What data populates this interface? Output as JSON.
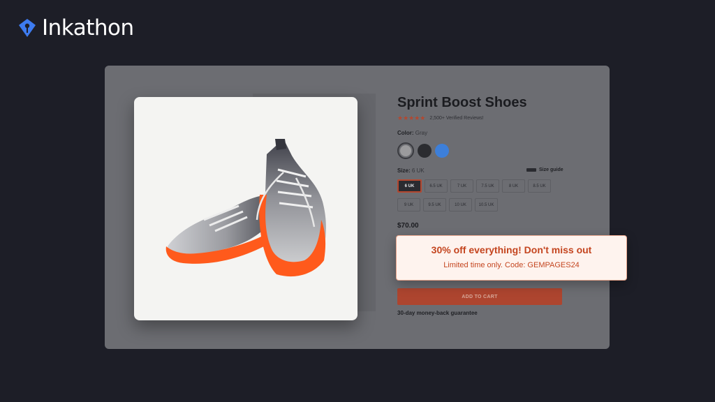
{
  "brand": {
    "name": "Inkathon",
    "icon": "pen-nib-icon",
    "color": "#3d7bf0"
  },
  "product": {
    "title": "Sprint Boost Shoes",
    "rating": {
      "stars": "★★★★★",
      "value": 5,
      "text": "2,500+ Verified Reviews!"
    },
    "color": {
      "label": "Color:",
      "value": "Gray",
      "options": [
        "#9b9b9d",
        "#2b2c30",
        "#3d7fd9"
      ],
      "selected": 0
    },
    "size": {
      "label": "Size:",
      "value": "6 UK",
      "guide": "Size guide",
      "options": [
        "6 UK",
        "6.5 UK",
        "7 UK",
        "7.5 UK",
        "8 UK",
        "8.5 UK",
        "9 UK",
        "9.5 UK",
        "10 UK",
        "10.5 UK"
      ],
      "selected": 0
    },
    "price": "$70.00",
    "add_to_cart": "ADD TO CART",
    "guarantee": "30-day money-back guarantee"
  },
  "promo": {
    "title": "30% off everything! Don't miss out",
    "subtitle": "Limited time only. Code: GEMPAGES24"
  },
  "colors": {
    "accent": "#b4472f",
    "promo_text": "#c4451f",
    "background": "#1d1e27"
  }
}
